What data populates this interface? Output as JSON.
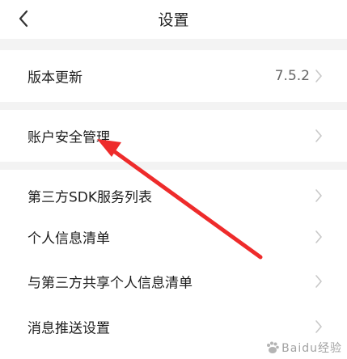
{
  "header": {
    "title": "设置"
  },
  "items": [
    {
      "label": "版本更新",
      "value": "7.5.2"
    },
    {
      "label": "账户安全管理"
    },
    {
      "label": "第三方SDK服务列表"
    },
    {
      "label": "个人信息清单"
    },
    {
      "label": "与第三方共享个人信息清单"
    },
    {
      "label": "消息推送设置"
    }
  ],
  "watermark": {
    "text": "Baidu经验"
  },
  "colors": {
    "annotation_arrow": "#ee2b2b",
    "section_gap": "#f3f3f3"
  }
}
